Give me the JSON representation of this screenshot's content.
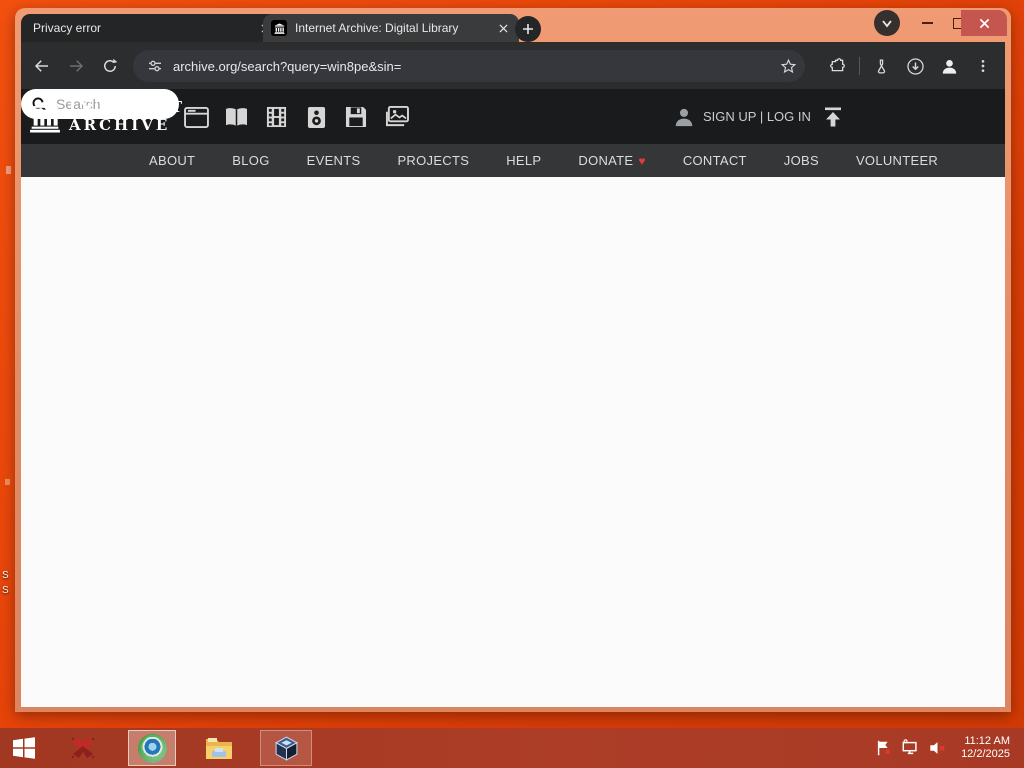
{
  "colors": {
    "desktop_orange": "#e8450a",
    "window_frame_salmon": "#e08a64",
    "taskbar_red": "#a83b25",
    "close_button_red": "#c4564f",
    "toolbar_dark": "#2c2d2f",
    "ia_header_black": "#1a1b1c",
    "nav_bar_gray": "#353638",
    "donate_heart_red": "#e53935"
  },
  "browser": {
    "tabs": [
      {
        "title": "Privacy error",
        "active": false
      },
      {
        "title": "Internet Archive: Digital Library",
        "active": true
      }
    ],
    "url": "archive.org/search?query=win8pe&sin="
  },
  "page": {
    "logo_line1": "INTERNET",
    "logo_line2": "ARCHIVE",
    "signup_login": "SIGN UP | LOG IN",
    "search_placeholder": "Search",
    "media_types": [
      "web",
      "texts",
      "video",
      "audio",
      "software",
      "images"
    ],
    "nav_items": [
      "ABOUT",
      "BLOG",
      "EVENTS",
      "PROJECTS",
      "HELP",
      "DONATE",
      "CONTACT",
      "JOBS",
      "VOLUNTEER"
    ],
    "donate_heart": "♥"
  },
  "taskbar": {
    "time": "11:12 AM",
    "date": "12/2/2025",
    "apps": [
      "start",
      "red-app",
      "chrome",
      "file-explorer",
      "virtualbox"
    ],
    "tray": [
      "action-center-flag",
      "network-monitor",
      "volume-muted"
    ]
  },
  "desktop": {
    "fragments": [
      "S",
      "S"
    ]
  }
}
